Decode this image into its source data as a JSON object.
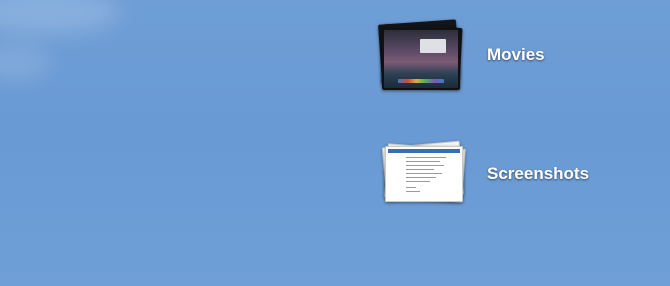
{
  "desktop": {
    "items": [
      {
        "label": "Movies",
        "icon": "movies-stack-icon"
      },
      {
        "label": "Screenshots",
        "icon": "screenshots-stack-icon"
      }
    ]
  }
}
